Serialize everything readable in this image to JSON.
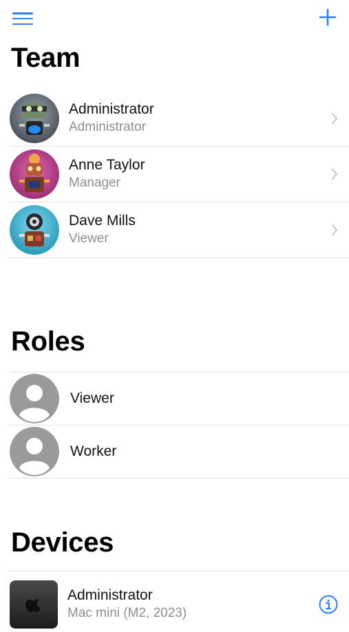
{
  "header": {
    "menu_icon": "hamburger-menu-icon",
    "add_icon": "plus-icon",
    "accent_color": "#2d7ff9"
  },
  "team": {
    "title": "Team",
    "members": [
      {
        "name": "Administrator",
        "role": "Administrator",
        "avatar": "robot-avatar-gray"
      },
      {
        "name": "Anne Taylor",
        "role": "Manager",
        "avatar": "robot-avatar-pink"
      },
      {
        "name": "Dave Mills",
        "role": "Viewer",
        "avatar": "robot-avatar-teal"
      }
    ]
  },
  "roles": {
    "title": "Roles",
    "items": [
      {
        "label": "Viewer",
        "icon": "person-placeholder-icon"
      },
      {
        "label": "Worker",
        "icon": "person-placeholder-icon"
      }
    ]
  },
  "devices": {
    "title": "Devices",
    "items": [
      {
        "name": "Administrator",
        "model": "Mac mini (M2, 2023)",
        "icon": "mac-mini-icon"
      }
    ]
  }
}
